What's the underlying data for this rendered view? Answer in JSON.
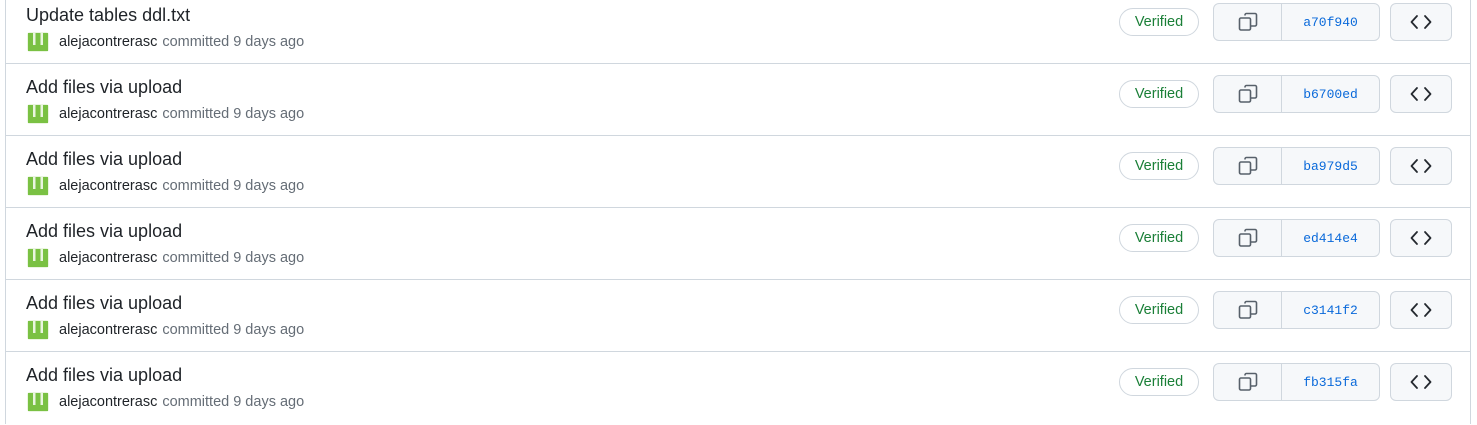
{
  "commits": [
    {
      "title": "Update tables ddl.txt",
      "author": "alejacontrerasc",
      "verb": "committed",
      "time": "9 days ago",
      "badge": "Verified",
      "sha": "a70f940"
    },
    {
      "title": "Add files via upload",
      "author": "alejacontrerasc",
      "verb": "committed",
      "time": "9 days ago",
      "badge": "Verified",
      "sha": "b6700ed"
    },
    {
      "title": "Add files via upload",
      "author": "alejacontrerasc",
      "verb": "committed",
      "time": "9 days ago",
      "badge": "Verified",
      "sha": "ba979d5"
    },
    {
      "title": "Add files via upload",
      "author": "alejacontrerasc",
      "verb": "committed",
      "time": "9 days ago",
      "badge": "Verified",
      "sha": "ed414e4"
    },
    {
      "title": "Add files via upload",
      "author": "alejacontrerasc",
      "verb": "committed",
      "time": "9 days ago",
      "badge": "Verified",
      "sha": "c3141f2"
    },
    {
      "title": "Add files via upload",
      "author": "alejacontrerasc",
      "verb": "committed",
      "time": "9 days ago",
      "badge": "Verified",
      "sha": "fb315fa"
    }
  ],
  "icons": {
    "copy": "copy-icon",
    "browse": "code-icon",
    "avatar": "identicon-avatar"
  },
  "colors": {
    "verified": "#1a7f37",
    "sha_link": "#0969da",
    "avatar_green": "#7ac143",
    "border": "#d0d7de"
  }
}
